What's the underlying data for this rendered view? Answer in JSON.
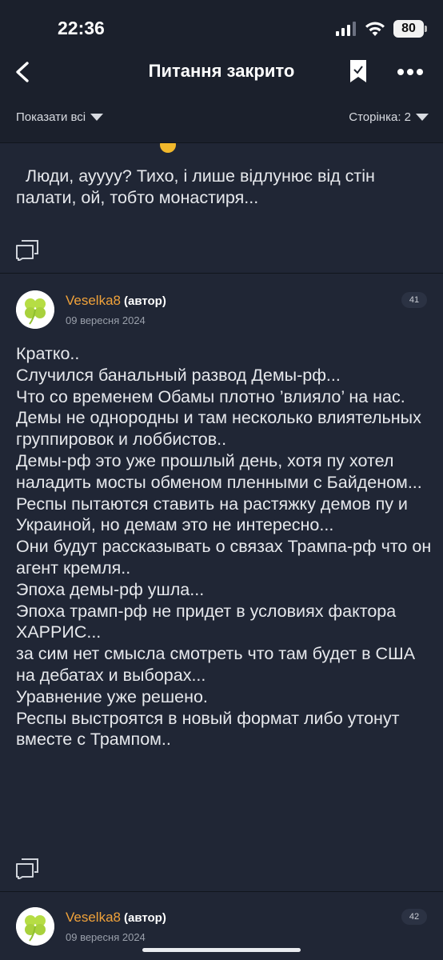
{
  "status_bar": {
    "time": "22:36",
    "battery": "80"
  },
  "nav": {
    "title": "Питання закрито"
  },
  "filter": {
    "show_all": "Показати всі",
    "page": "Сторінка: 2"
  },
  "posts": [
    {
      "text": "  Люди, ауууу? Тихо, і лише відлунює від стін палати, ой, тобто монастиря..."
    },
    {
      "author": "Veselka8",
      "role": "(автор)",
      "date": "09 вересня 2024",
      "number": "41",
      "text": "Кратко..\nСлучился банальный развод Демы-рф...\nЧто со временем Обамы плотно ’влияло’ на нас.\nДемы не однородны и там несколько влиятельных группировок и лоббистов..\nДемы-рф это уже прошлый день, хотя пу хотел наладить мосты обменом пленными с Байденом...\nРеспы пытаются ставить на растяжку демов пу и Украиной, но демам это не интересно...\nОни будут рассказывать о связах Трампа-рф что он агент кремля..\nЭпоха демы-рф ушла...\nЭпоха трамп-рф не придет в условиях фактора ХАРРИС...\nза сим нет смысла смотреть что там будет в США на дебатах и выборах...\nУравнение уже решено.\nРеспы выстроятся в новый формат либо утонут вместе с Трампом.."
    },
    {
      "author": "Veselka8",
      "role": "(автор)",
      "date": "09 вересня 2024",
      "number": "42"
    }
  ],
  "icons": {
    "back": "chevron-left-icon",
    "bookmark": "bookmark-check-icon",
    "more": "more-horizontal-icon",
    "quote": "quote-icon",
    "avatar": "clover-avatar"
  },
  "colors": {
    "accent": "#f0a23a",
    "background": "#202635",
    "bar": "#1b202c"
  }
}
